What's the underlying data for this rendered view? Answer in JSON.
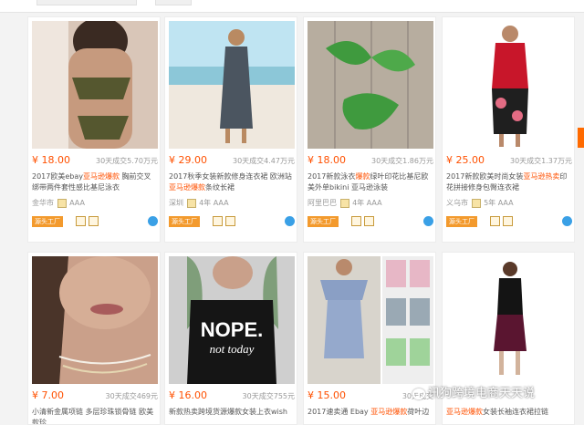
{
  "products": [
    {
      "price": "¥ 18.00",
      "sold": "30天成交5.70万元",
      "title_pre": "2017欧美ebay",
      "title_hl": "亚马逊爆款",
      "title_post": " 胸前交叉绑带两件套性感比基尼泳衣",
      "seller": "金华市",
      "aaa": "AAA",
      "tag": "",
      "image_desc": "olive bikini"
    },
    {
      "price": "¥ 29.00",
      "sold": "30天成交4.47万元",
      "title_pre": "2017秋季女装新款修身连衣裙 欧洲站 ",
      "title_hl": "亚马逊爆款",
      "title_post": "条纹长裙",
      "seller": "深圳",
      "aaa": "4年 AAA",
      "tag": "源头工厂",
      "image_desc": "beach dress"
    },
    {
      "price": "¥ 18.00",
      "sold": "30天成交1.86万元",
      "title_pre": "2017新款泳衣",
      "title_hl": "爆款",
      "title_post": "绿叶印花比基尼欧美外单bikini 亚马逊泳装",
      "seller": "阿里巴巴",
      "aaa": "4年 AAA",
      "tag": "源头工厂",
      "image_desc": "leaf bikini"
    },
    {
      "price": "¥ 25.00",
      "sold": "30天成交1.37万元",
      "title_pre": "2017新款欧美时尚女装",
      "title_hl": "亚马逊热卖",
      "title_post": "印花拼接修身包臀连衣裙",
      "seller": "义乌市",
      "aaa": "5年 AAA",
      "tag": "源头工厂",
      "image_desc": "red dress"
    },
    {
      "price": "¥ 7.00",
      "sold": "30天成交469元",
      "title_pre": "小清新金属项链 多层",
      "title_hl": "",
      "title_post": "珍珠锁骨链 欧美款珍",
      "seller": "",
      "aaa": "",
      "tag": "",
      "image_desc": "necklace"
    },
    {
      "price": "¥ 16.00",
      "sold": "30天成交755元",
      "title_pre": "新款热卖跨境货源爆款女装上衣wish",
      "title_hl": "",
      "title_post": "",
      "seller": "",
      "aaa": "",
      "tag": "",
      "image_desc": "NOPE tee",
      "tee_line1": "NOPE.",
      "tee_line2": "not today"
    },
    {
      "price": "¥ 15.00",
      "sold": "30天成交",
      "title_pre": "2017速卖通 Ebay ",
      "title_hl": "亚马逊爆款",
      "title_post": "荷叶边",
      "seller": "",
      "aaa": "",
      "tag": "",
      "image_desc": "ruffle dress"
    },
    {
      "price": "",
      "sold": "",
      "title_pre": "",
      "title_hl": "亚马逊爆款",
      "title_post": "女装长袖连衣裙拉链",
      "seller": "",
      "aaa": "",
      "tag": "",
      "image_desc": "black dress"
    }
  ],
  "watermark": "讯狗跨境电商天天说",
  "colors": {
    "price": "#ff5000",
    "tag": "#f39a2d",
    "blue_badge": "#3aa0e6"
  }
}
